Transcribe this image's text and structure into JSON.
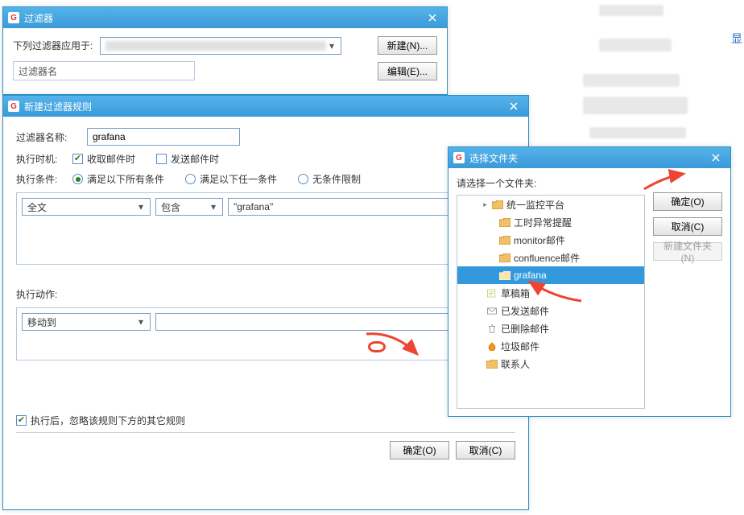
{
  "bg_char": "显",
  "win_filter": {
    "title": "过滤器",
    "applies_label": "下列过滤器应用于:",
    "applies_value": "",
    "btn_new": "新建(N)...",
    "btn_edit": "编辑(E)...",
    "list_header": "过滤器名"
  },
  "win_rule": {
    "title": "新建过滤器规则",
    "name_label": "过滤器名称:",
    "name_value": "grafana",
    "timing_label": "执行时机:",
    "chk_receive": "收取邮件时",
    "chk_send": "发送邮件时",
    "cond_label": "执行条件:",
    "rad_all": "满足以下所有条件",
    "rad_any": "满足以下任一条件",
    "rad_none": "无条件限制",
    "cond_field": "全文",
    "cond_op": "包含",
    "cond_value": "\"grafana\"",
    "action_label": "执行动作:",
    "action_type": "移动到",
    "action_target": "",
    "ignore_after": "执行后，忽略该规则下方的其它规则",
    "ok": "确定(O)",
    "cancel": "取消(C)"
  },
  "win_folder": {
    "title": "选择文件夹",
    "prompt": "请选择一个文件夹:",
    "ok": "确定(O)",
    "cancel": "取消(C)",
    "new_folder": "新建文件夹(N)",
    "tree": {
      "t0": "统一监控平台",
      "t1": "工时异常提醒",
      "t2": "monitor邮件",
      "t3": "confluence邮件",
      "t4": "grafana",
      "t5": "草稿箱",
      "t6": "已发送邮件",
      "t7": "已删除邮件",
      "t8": "垃圾邮件",
      "t9": "联系人"
    }
  }
}
